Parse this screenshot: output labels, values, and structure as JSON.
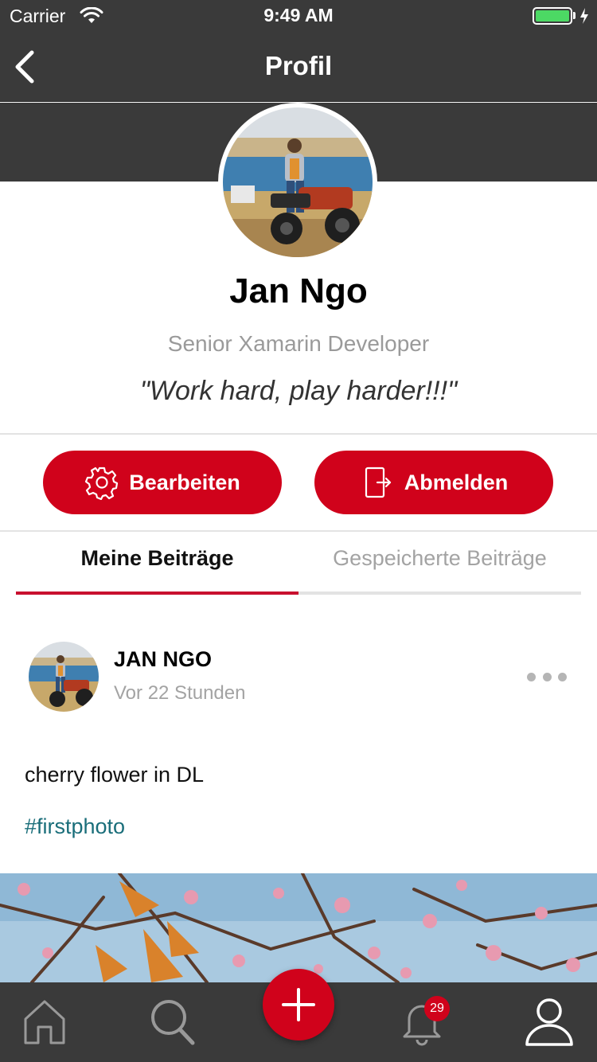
{
  "status_bar": {
    "carrier": "Carrier",
    "time": "9:49 AM",
    "battery_level": 1.0,
    "battery_color": "#4cd964"
  },
  "nav": {
    "title": "Profil",
    "back_icon": "chevron-left-icon"
  },
  "profile": {
    "name": "Jan Ngo",
    "role": "Senior Xamarin Developer",
    "quote": "\"Work hard, play harder!!!\""
  },
  "actions": {
    "edit_label": "Bearbeiten",
    "edit_icon": "gear-icon",
    "logout_label": "Abmelden",
    "logout_icon": "logout-icon"
  },
  "tabs": [
    {
      "label": "Meine Beiträge",
      "active": true
    },
    {
      "label": "Gespeicherte Beiträge",
      "active": false
    }
  ],
  "post": {
    "author": "JAN NGO",
    "time": "Vor 22 Stunden",
    "text": "cherry flower in DL",
    "hashtag": "#firstphoto",
    "more_icon": "more-horizontal-icon"
  },
  "tabbar": {
    "items": [
      "home-icon",
      "search-icon",
      "add-icon",
      "bell-icon",
      "user-icon"
    ],
    "notification_count": "29"
  },
  "colors": {
    "accent": "#d0021b",
    "header_bg": "#3a3a3a",
    "hashtag": "#1a6e7a"
  }
}
